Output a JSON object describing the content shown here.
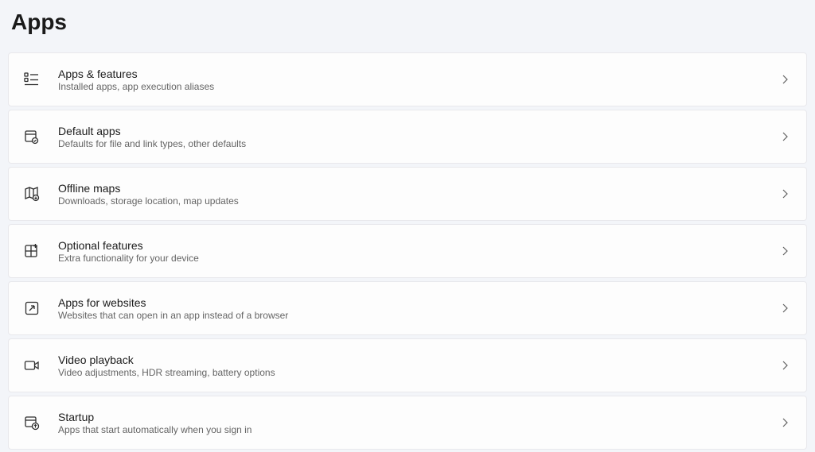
{
  "pageTitle": "Apps",
  "items": [
    {
      "id": "apps-features",
      "icon": "apps-list-icon",
      "title": "Apps & features",
      "subtitle": "Installed apps, app execution aliases"
    },
    {
      "id": "default-apps",
      "icon": "default-apps-icon",
      "title": "Default apps",
      "subtitle": "Defaults for file and link types, other defaults"
    },
    {
      "id": "offline-maps",
      "icon": "map-icon",
      "title": "Offline maps",
      "subtitle": "Downloads, storage location, map updates"
    },
    {
      "id": "optional-features",
      "icon": "optional-features-icon",
      "title": "Optional features",
      "subtitle": "Extra functionality for your device"
    },
    {
      "id": "apps-for-websites",
      "icon": "websites-icon",
      "title": "Apps for websites",
      "subtitle": "Websites that can open in an app instead of a browser"
    },
    {
      "id": "video-playback",
      "icon": "video-icon",
      "title": "Video playback",
      "subtitle": "Video adjustments, HDR streaming, battery options"
    },
    {
      "id": "startup",
      "icon": "startup-icon",
      "title": "Startup",
      "subtitle": "Apps that start automatically when you sign in"
    }
  ]
}
